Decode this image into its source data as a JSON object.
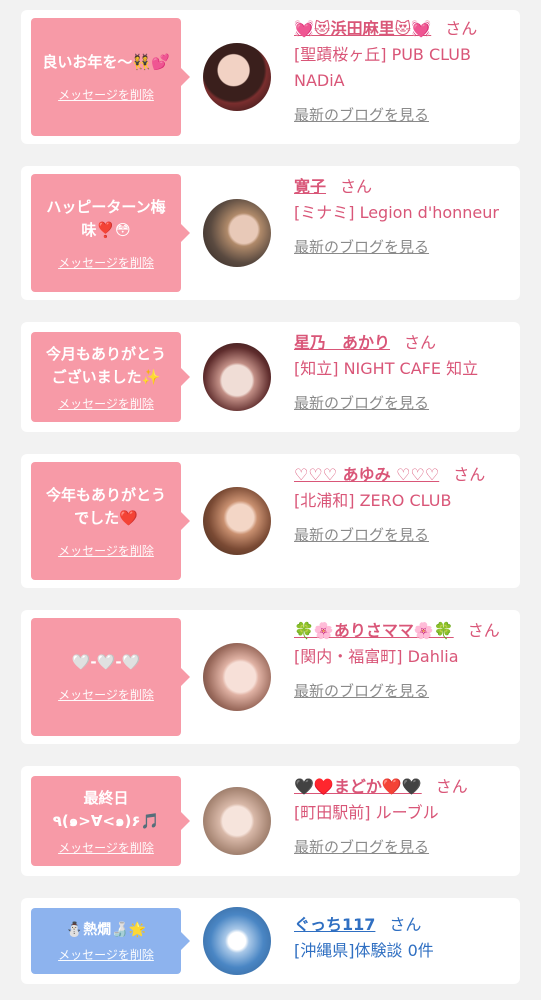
{
  "delete_label": "メッセージを削除",
  "blog_label": "最新のブログを見る",
  "san": "さん",
  "cards": [
    {
      "message": "良いお年を〜👯💕",
      "name": "💓😻浜田麻里😻💓",
      "shop": "[聖蹟桜ヶ丘] PUB CLUB NADiA",
      "blog": true,
      "color": "pink"
    },
    {
      "message": "ハッピーターン梅味❣️😳",
      "name": "寛子",
      "shop": "[ミナミ] Legion d'honneur",
      "blog": true,
      "color": "pink"
    },
    {
      "message": "今月もありがとうございました✨",
      "name": "星乃　あかり",
      "shop": "[知立] NIGHT CAFE 知立",
      "blog": true,
      "color": "pink"
    },
    {
      "message": "今年もありがとうでした❤️",
      "name": "♡♡♡ あゆみ ♡♡♡",
      "shop": "[北浦和] ZERO CLUB",
      "blog": true,
      "color": "pink"
    },
    {
      "message": "🤍-🤍-🤍",
      "name": "🍀🌸ありさママ🌸🍀",
      "shop": "[関内・福富町] Dahlia",
      "blog": true,
      "color": "pink"
    },
    {
      "message": "最終日٩(๑>∀<๑)۶🎵",
      "name": "🖤♥️まどか❤️🖤",
      "shop": "[町田駅前] ルーブル",
      "blog": true,
      "color": "pink"
    },
    {
      "message": "⛄熱燗🍶🌟",
      "name": "ぐっち117",
      "shop": "[沖縄県]体験談 0件",
      "blog": false,
      "color": "blue"
    }
  ],
  "colors": {
    "pink_bubble": "#f79aa7",
    "blue_bubble": "#8db3ee",
    "name_pink": "#d95678",
    "name_blue": "#2f6fc2"
  }
}
